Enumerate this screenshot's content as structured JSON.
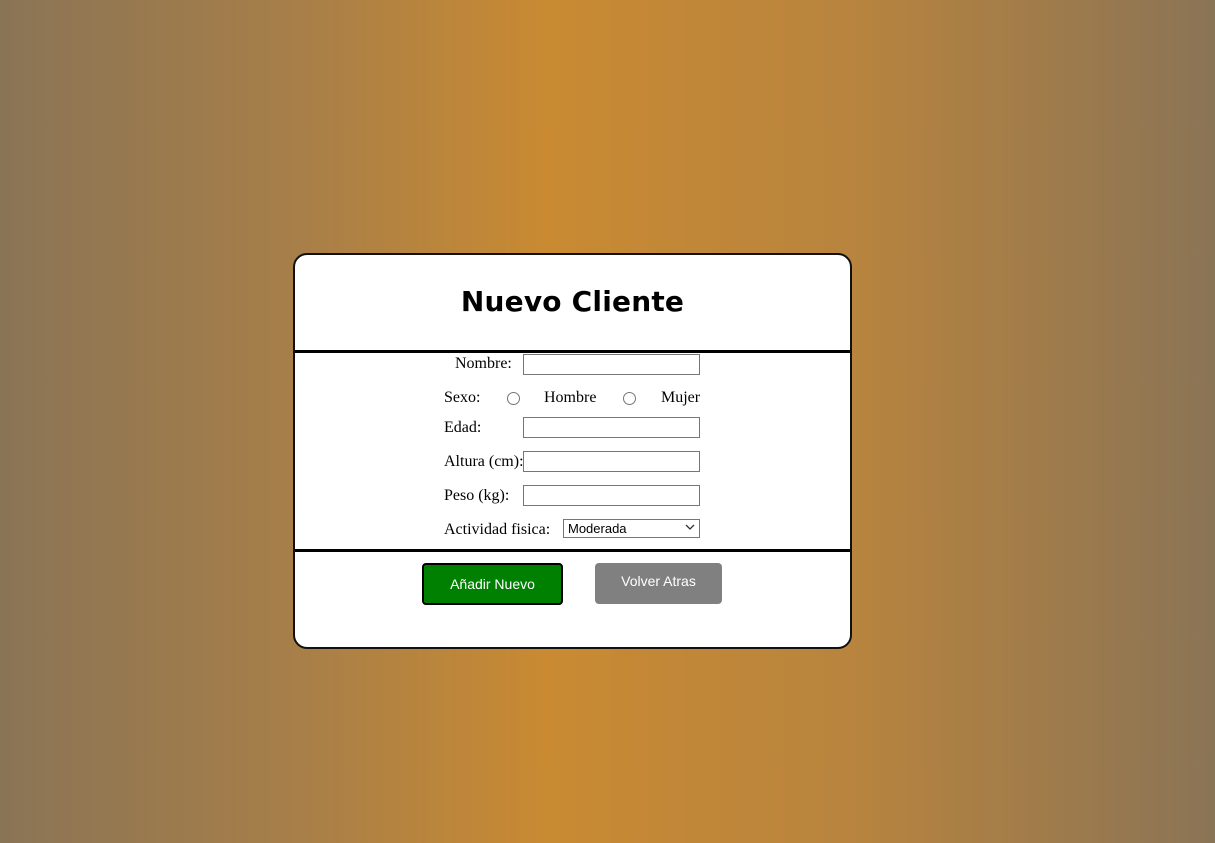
{
  "card": {
    "title": "Nuevo Cliente"
  },
  "form": {
    "nombre_label": "Nombre:",
    "nombre_value": "",
    "sexo_label": "Sexo:",
    "sexo_options": [
      "Hombre",
      "Mujer"
    ],
    "edad_label": "Edad:",
    "edad_value": "",
    "altura_label": "Altura (cm):",
    "altura_value": "",
    "peso_label": "Peso (kg):",
    "peso_value": "",
    "actividad_label": "Actividad fisica:",
    "actividad_selected": "Moderada"
  },
  "buttons": {
    "add_label": "Añadir Nuevo",
    "back_label": "Volver Atras"
  },
  "colors": {
    "add_button": "#008000",
    "back_button": "#808080"
  },
  "icons": {
    "select_arrow": "chevron-down-icon"
  }
}
